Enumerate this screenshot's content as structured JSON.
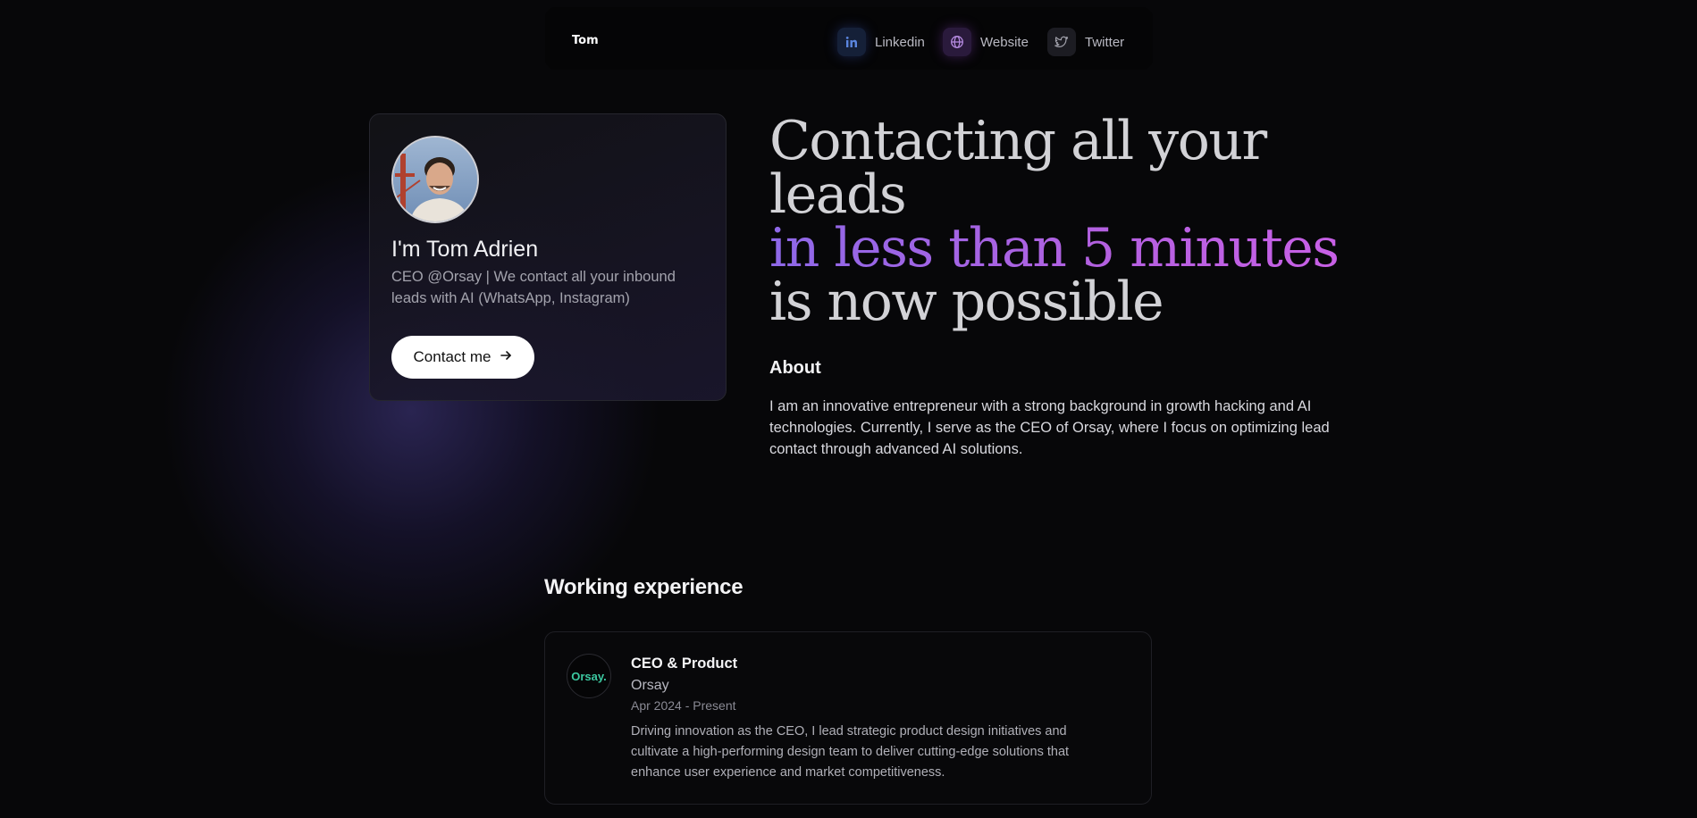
{
  "nav": {
    "logo": "Tom",
    "links": [
      {
        "label": "Linkedin",
        "icon": "linkedin-icon",
        "color": "#4f7bd6"
      },
      {
        "label": "Website",
        "icon": "globe-icon",
        "color": "#b07ad8"
      },
      {
        "label": "Twitter",
        "icon": "twitter-icon",
        "color": "#9a9aa4"
      }
    ]
  },
  "profile": {
    "name": "I'm Tom Adrien",
    "bio": "CEO @Orsay | We contact all your inbound leads with AI (WhatsApp, Instagram)",
    "contact_label": "Contact me",
    "avatar_icon": "avatar"
  },
  "hero": {
    "line1": "Contacting all your",
    "line2": "leads",
    "line3": "in less than 5 minutes",
    "line4": "is now possible",
    "accent_gradient": [
      "#8e68e8",
      "#c860e6"
    ]
  },
  "about": {
    "title": "About",
    "text": "I am an innovative entrepreneur with a strong background in growth hacking and AI technologies. Currently, I serve as the CEO of Orsay, where I focus on optimizing lead contact through advanced AI solutions."
  },
  "experience": {
    "title": "Working experience",
    "items": [
      {
        "logo_text": "Orsay.",
        "role": "CEO & Product",
        "company": "Orsay",
        "dates": "Apr 2024 - Present",
        "description": "Driving innovation as the CEO, I lead strategic product design initiatives and cultivate a high-performing design team to deliver cutting-edge solutions that enhance user experience and market competitiveness."
      }
    ]
  }
}
